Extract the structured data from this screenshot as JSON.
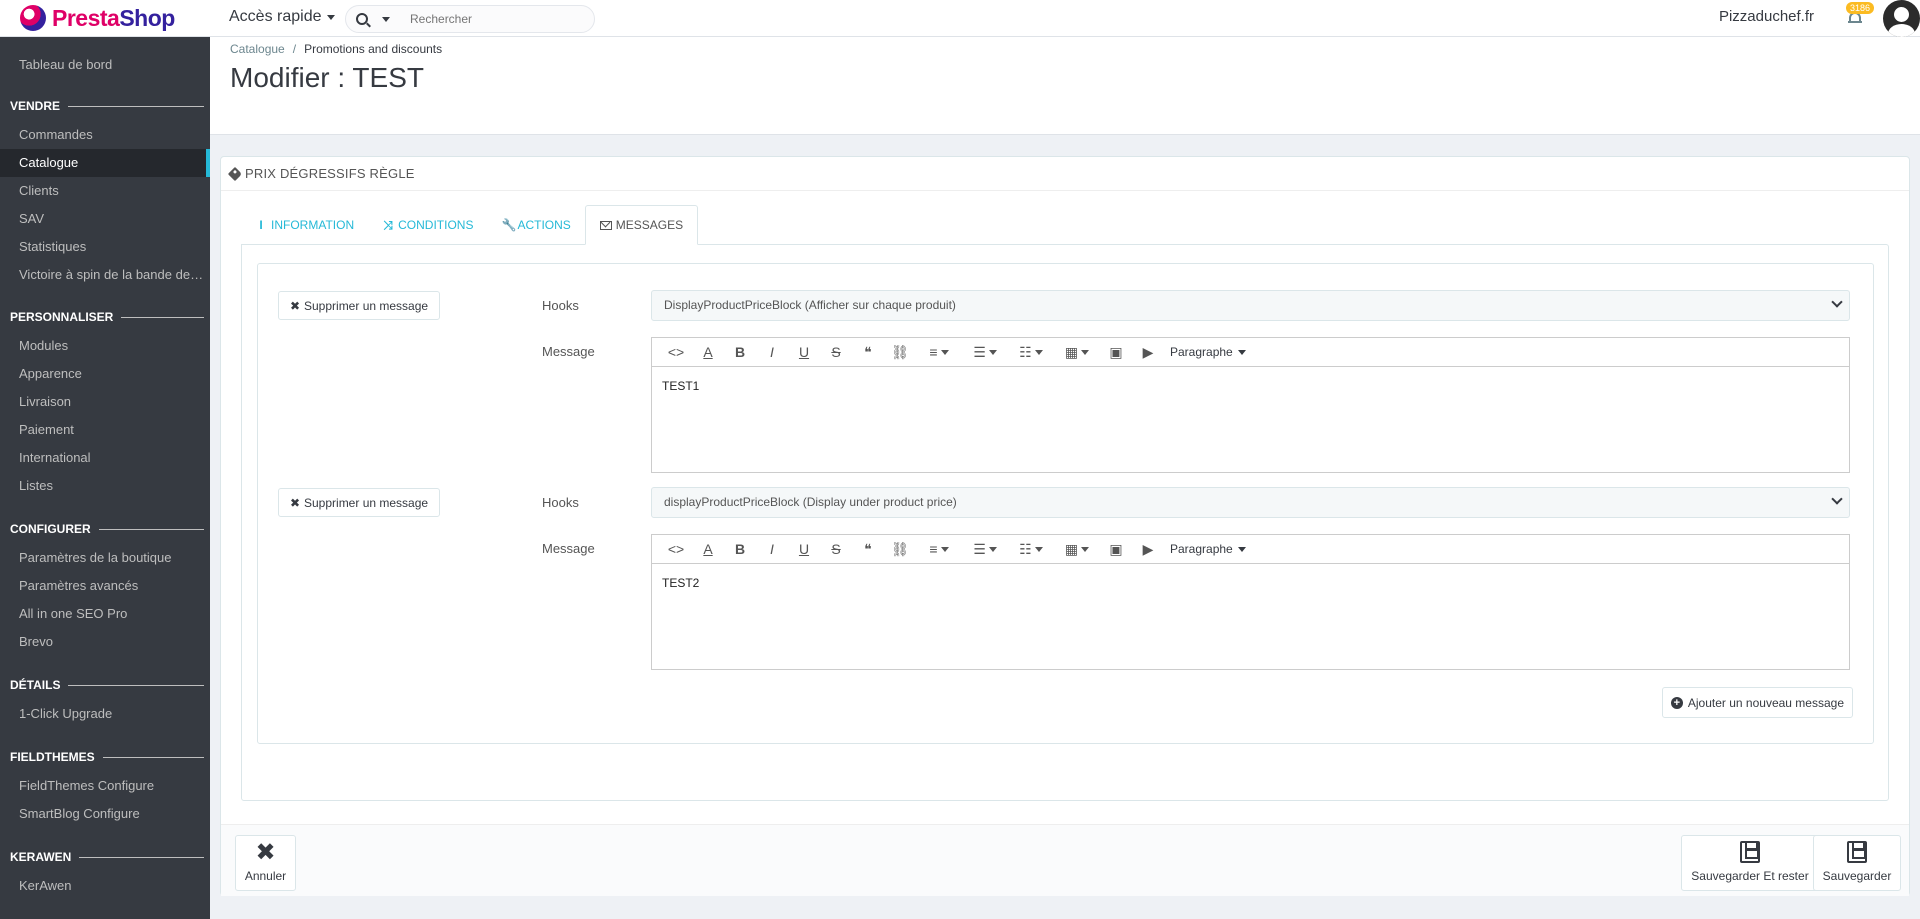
{
  "header": {
    "logo_text_1": "Presta",
    "logo_text_2": "Shop",
    "quick_access": "Accès rapide",
    "search_placeholder": "Rechercher",
    "shop_name": "Pizzaduchef.fr",
    "notif_count": "3186"
  },
  "sidebar": {
    "dashboard": "Tableau de bord",
    "sections": [
      {
        "title": "VENDRE",
        "items": [
          "Commandes",
          "Catalogue",
          "Clients",
          "SAV",
          "Statistiques",
          "Victoire à spin de la bande de c..."
        ]
      },
      {
        "title": "PERSONNALISER",
        "items": [
          "Modules",
          "Apparence",
          "Livraison",
          "Paiement",
          "International",
          "Listes"
        ]
      },
      {
        "title": "CONFIGURER",
        "items": [
          "Paramètres de la boutique",
          "Paramètres avancés",
          "All in one SEO Pro",
          "Brevo"
        ]
      },
      {
        "title": "DÉTAILS",
        "items": [
          "1-Click Upgrade"
        ]
      },
      {
        "title": "FIELDTHEMES",
        "items": [
          "FieldThemes Configure",
          "SmartBlog Configure"
        ]
      },
      {
        "title": "KERAWEN",
        "items": [
          "KerAwen"
        ]
      }
    ],
    "active_item": "Catalogue"
  },
  "breadcrumb": {
    "parent": "Catalogue",
    "current": "Promotions and discounts"
  },
  "page_title": "Modifier : TEST",
  "panel": {
    "heading": "PRIX DÉGRESSIFS RÈGLE",
    "tabs": [
      "INFORMATION",
      "CONDITIONS",
      "ACTIONS",
      "MESSAGES"
    ],
    "active_tab": "MESSAGES"
  },
  "messages": [
    {
      "delete_label": "Supprimer un message",
      "hooks_label": "Hooks",
      "hook_value": "DisplayProductPriceBlock (Afficher sur chaque produit)",
      "message_label": "Message",
      "content": "TEST1"
    },
    {
      "delete_label": "Supprimer un message",
      "hooks_label": "Hooks",
      "hook_value": "displayProductPriceBlock (Display under product price)",
      "message_label": "Message",
      "content": "TEST2"
    }
  ],
  "editor": {
    "paragraph_label": "Paragraphe"
  },
  "add_message": "Ajouter un nouveau message",
  "footer": {
    "cancel": "Annuler",
    "save_stay": "Sauvegarder Et rester",
    "save": "Sauvegarder"
  }
}
